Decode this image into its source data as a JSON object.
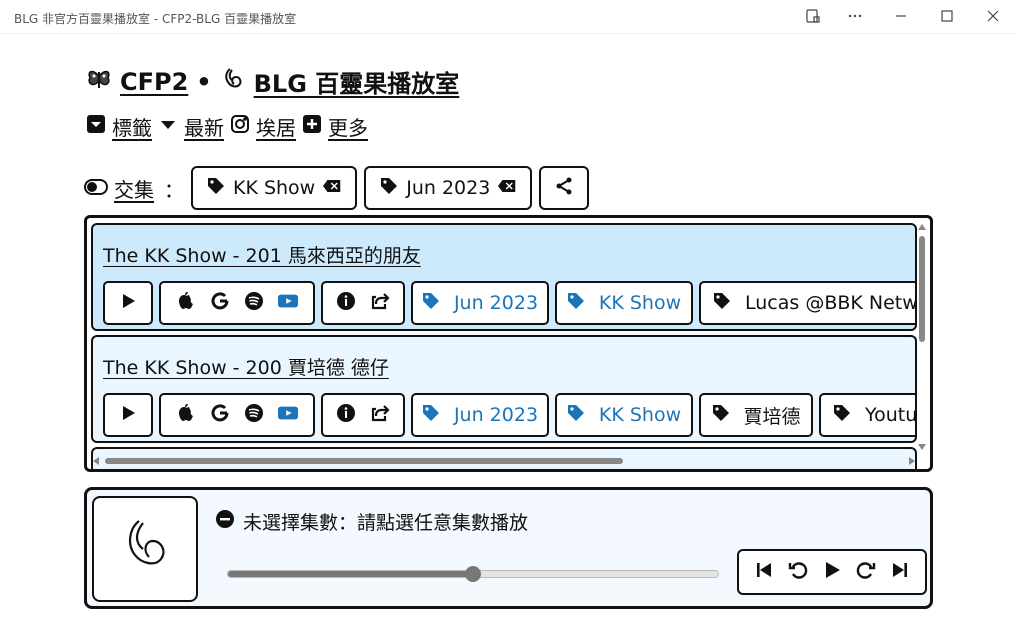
{
  "window": {
    "title": "BLG 非官方百靈果播放室 - CFP2-BLG 百靈果播放室"
  },
  "header": {
    "site": "CFP2",
    "separator": "•",
    "subtitle": "BLG 百靈果播放室"
  },
  "nav": {
    "tags": "標籤",
    "latest": "最新",
    "instagram": "埃居",
    "more": "更多"
  },
  "filter": {
    "label": "交集",
    "colon": "：",
    "chips": [
      "KK Show",
      "Jun 2023"
    ]
  },
  "episodes": [
    {
      "title": "The KK Show - 201 馬來西亞的朋友",
      "tags": [
        "Jun 2023",
        "KK Show",
        "Lucas @BBK Network"
      ],
      "highlighted_tags": [
        true,
        true,
        false
      ]
    },
    {
      "title": "The KK Show - 200 賈培德 德仔",
      "tags": [
        "Jun 2023",
        "KK Show",
        "賈培德",
        "Youtube"
      ],
      "highlighted_tags": [
        true,
        true,
        false,
        false
      ]
    }
  ],
  "player": {
    "status": "未選擇集數：請點選任意集數播放",
    "progress": 0.5
  },
  "colors": {
    "accent": "#1b75b8",
    "active_row": "#cde9fc",
    "row": "#eaf6ff"
  }
}
